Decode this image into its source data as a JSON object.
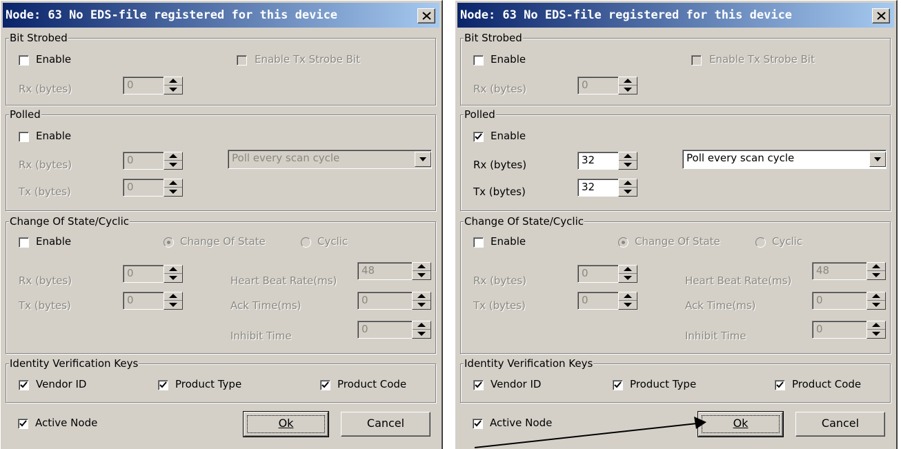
{
  "dialog_left": {
    "title": "Node: 63 No EDS-file registered for this device",
    "bit_strobed": {
      "legend": "Bit Strobed",
      "enable_label": "Enable",
      "enable_checked": false,
      "enable_tx_strobe_label": "Enable Tx Strobe Bit",
      "rx_label": "Rx (bytes)",
      "rx_value": "0"
    },
    "polled": {
      "legend": "Polled",
      "enable_label": "Enable",
      "enable_checked": false,
      "rx_label": "Rx (bytes)",
      "rx_value": "0",
      "tx_label": "Tx (bytes)",
      "tx_value": "0",
      "poll_option": "Poll every scan cycle"
    },
    "cos": {
      "legend": "Change Of State/Cyclic",
      "enable_label": "Enable",
      "enable_checked": false,
      "change_of_state_label": "Change Of State",
      "cyclic_label": "Cyclic",
      "rx_label": "Rx (bytes)",
      "rx_value": "0",
      "tx_label": "Tx (bytes)",
      "tx_value": "0",
      "heartbeat_label": "Heart Beat Rate(ms)",
      "heartbeat_value": "48",
      "ack_label": "Ack Time(ms)",
      "ack_value": "0",
      "inhibit_label": "Inhibit Time",
      "inhibit_value": "0"
    },
    "identity": {
      "legend": "Identity Verification Keys",
      "vendor_id_label": "Vendor ID",
      "product_type_label": "Product Type",
      "product_code_label": "Product Code"
    },
    "active_node_label": "Active Node",
    "ok_label": "Ok",
    "cancel_label": "Cancel"
  },
  "dialog_right": {
    "title": "Node: 63 No EDS-file registered for this device",
    "bit_strobed": {
      "legend": "Bit Strobed",
      "enable_label": "Enable",
      "enable_checked": false,
      "enable_tx_strobe_label": "Enable Tx Strobe Bit",
      "rx_label": "Rx (bytes)",
      "rx_value": "0"
    },
    "polled": {
      "legend": "Polled",
      "enable_label": "Enable",
      "enable_checked": true,
      "rx_label": "Rx (bytes)",
      "rx_value": "32",
      "tx_label": "Tx (bytes)",
      "tx_value": "32",
      "poll_option": "Poll every scan cycle"
    },
    "cos": {
      "legend": "Change Of State/Cyclic",
      "enable_label": "Enable",
      "enable_checked": false,
      "change_of_state_label": "Change Of State",
      "cyclic_label": "Cyclic",
      "rx_label": "Rx (bytes)",
      "rx_value": "0",
      "tx_label": "Tx (bytes)",
      "tx_value": "0",
      "heartbeat_label": "Heart Beat Rate(ms)",
      "heartbeat_value": "48",
      "ack_label": "Ack Time(ms)",
      "ack_value": "0",
      "inhibit_label": "Inhibit Time",
      "inhibit_value": "0"
    },
    "identity": {
      "legend": "Identity Verification Keys",
      "vendor_id_label": "Vendor ID",
      "product_type_label": "Product Type",
      "product_code_label": "Product Code"
    },
    "active_node_label": "Active Node",
    "ok_label": "Ok",
    "cancel_label": "Cancel"
  },
  "colors": {
    "title_start": "#0a246a",
    "title_end": "#a6caf0",
    "dialog_face": "#d4d0c8",
    "disabled_text": "#8a8880"
  },
  "icons": [
    "close-icon",
    "checkmark-icon",
    "spin-up-icon",
    "spin-down-icon",
    "dropdown-arrow-icon",
    "annotation-arrow-icon"
  ]
}
